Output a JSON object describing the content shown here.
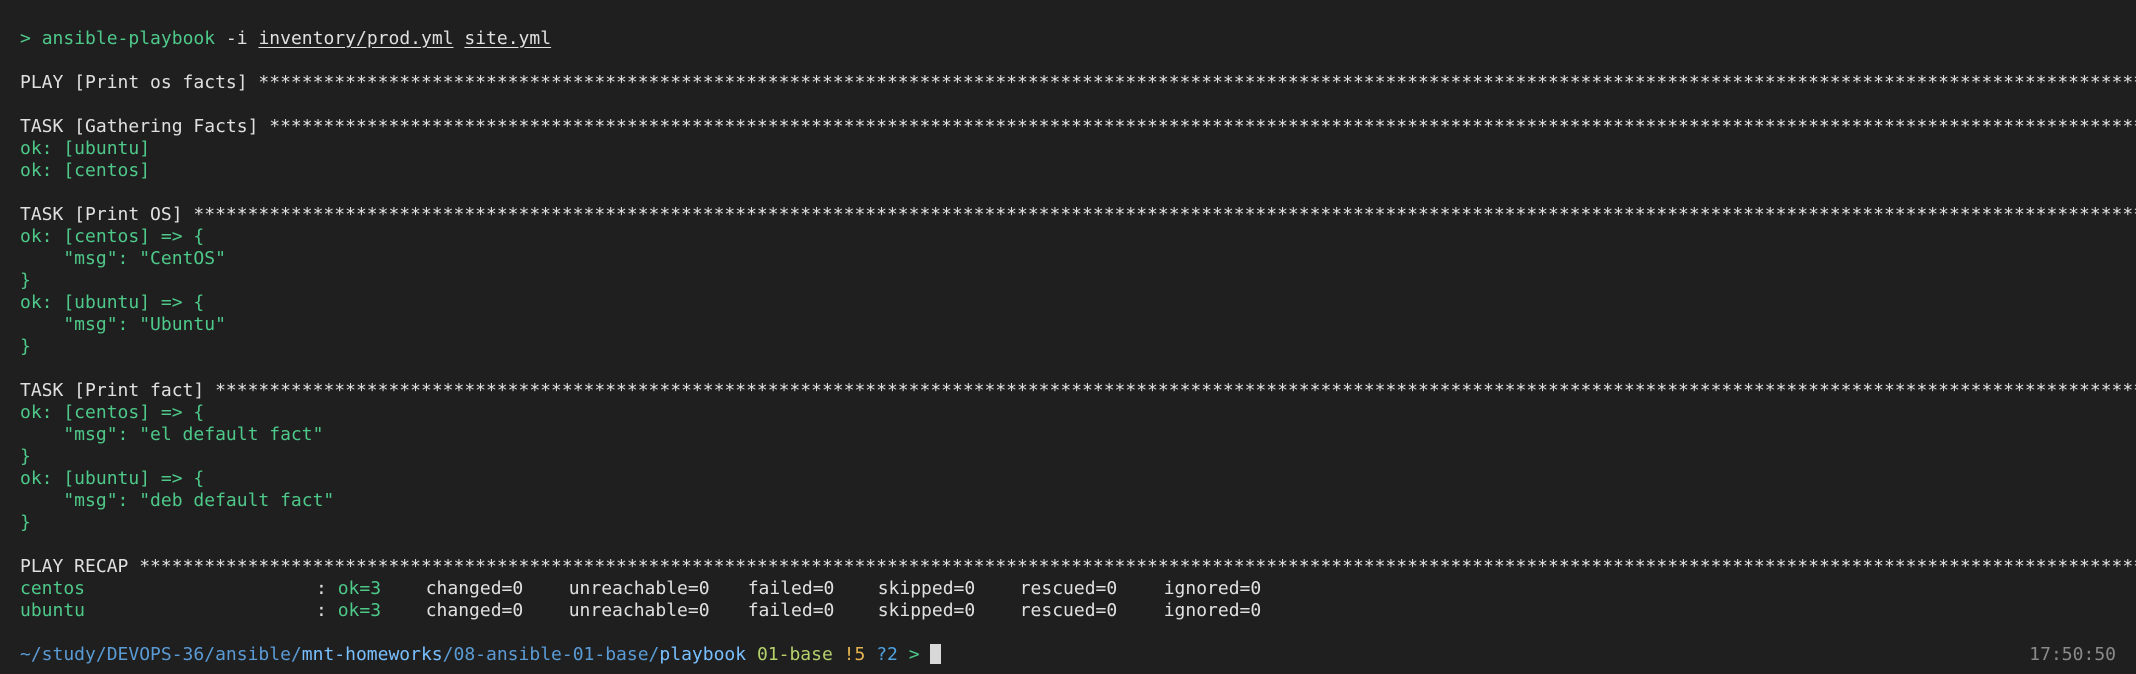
{
  "command": {
    "prompt_symbol": ">",
    "program": "ansible-playbook",
    "flag": "-i",
    "inventory": "inventory/prod.yml",
    "playbook": "site.yml"
  },
  "play": {
    "header": "PLAY [Print os facts] ",
    "stars": "*******************************************************************************************************************************************************************************************"
  },
  "task_gather": {
    "header": "TASK [Gathering Facts] ",
    "stars": "*****************************************************************************************************************************************************************************************",
    "lines": [
      "ok: [ubuntu]",
      "ok: [centos]"
    ]
  },
  "task_os": {
    "header": "TASK [Print OS] ",
    "stars": "************************************************************************************************************************************************************************************************",
    "lines": [
      "ok: [centos] => {",
      "    \"msg\": \"CentOS\"",
      "}",
      "ok: [ubuntu] => {",
      "    \"msg\": \"Ubuntu\"",
      "}"
    ]
  },
  "task_fact": {
    "header": "TASK [Print fact] ",
    "stars": "**********************************************************************************************************************************************************************************************",
    "lines": [
      "ok: [centos] => {",
      "    \"msg\": \"el default fact\"",
      "}",
      "ok: [ubuntu] => {",
      "    \"msg\": \"deb default fact\"",
      "}"
    ]
  },
  "recap": {
    "header": "PLAY RECAP ",
    "stars": "*********************************************************************************************************************************************************************************************************",
    "rows": [
      {
        "host": "centos",
        "sep": ": ",
        "ok": "ok=3",
        "changed": "changed=0",
        "unreachable": "unreachable=0",
        "failed": "failed=0",
        "skipped": "skipped=0",
        "rescued": "rescued=0",
        "ignored": "ignored=0"
      },
      {
        "host": "ubuntu",
        "sep": ": ",
        "ok": "ok=3",
        "changed": "changed=0",
        "unreachable": "unreachable=0",
        "failed": "failed=0",
        "skipped": "skipped=0",
        "rescued": "rescued=0",
        "ignored": "ignored=0"
      }
    ]
  },
  "prompt": {
    "path_prefix": "~/study/DEVOPS-36/ansible/",
    "path_repo": "mnt-homeworks",
    "path_mid": "/08-ansible-01-base/",
    "path_dir": "playbook",
    "branch": "01-base",
    "dirty": "!5",
    "untracked": "?2",
    "symbol": ">",
    "time": "17:50:50"
  },
  "colors": {
    "background": "#1f1f1f",
    "ok_green": "#4ec98a",
    "path_blue": "#79c0ff",
    "branch_green": "#b5d16c",
    "dirty_yellow": "#e6b450"
  }
}
